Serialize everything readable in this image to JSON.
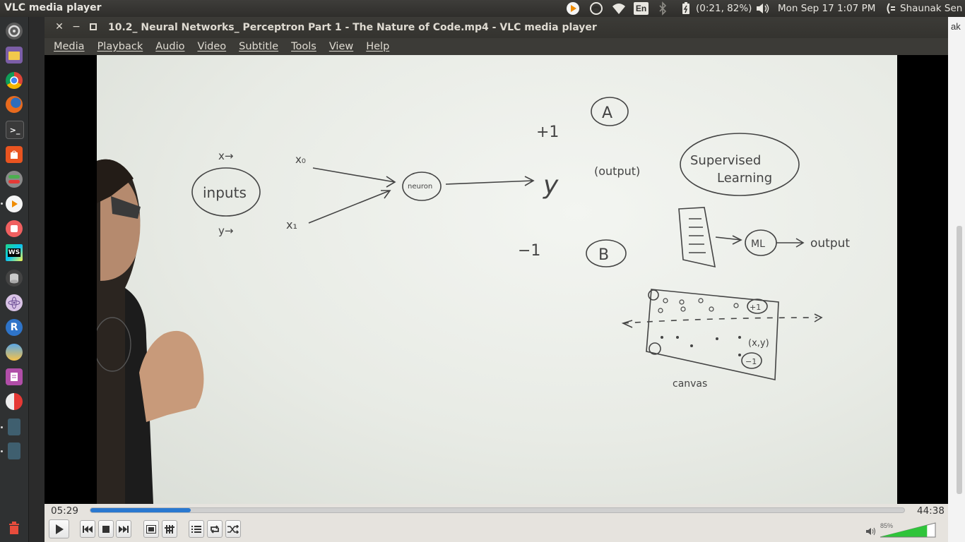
{
  "top_panel": {
    "app_title": "VLC media player",
    "battery": "(0:21, 82%)",
    "keyboard_layout": "En",
    "clock": "Mon Sep 17  1:07 PM",
    "user": "Shaunak Sen"
  },
  "launcher": {
    "items": [
      "dash-home",
      "files",
      "chrome",
      "firefox",
      "terminal",
      "software-center",
      "settings-toggle",
      "vlc",
      "app-record",
      "webstorm",
      "database",
      "atom",
      "r-studio",
      "weather",
      "document-viewer",
      "disk-usage",
      "window-a",
      "window-b"
    ],
    "trash": "trash"
  },
  "desktop_right": {
    "corner_text": "ak"
  },
  "vlc": {
    "window_title": "10.2_ Neural Networks_ Perceptron Part 1 - The Nature of Code.mp4 - VLC media player",
    "menu": [
      "Media",
      "Playback",
      "Audio",
      "Video",
      "Subtitle",
      "Tools",
      "View",
      "Help"
    ],
    "elapsed": "05:29",
    "total": "44:38",
    "progress": 0.123,
    "volume_label": "85%",
    "volume": 0.85,
    "whiteboard": {
      "inputs": "inputs",
      "x_arrow": "x→",
      "y_arrow": "y→",
      "x0": "x₀",
      "x1": "x₁",
      "neuron": "neuron",
      "y": "y",
      "plus1": "+1",
      "minus1": "−1",
      "output": "(output)",
      "A": "A",
      "B": "B",
      "supervised": "Supervised",
      "learning": "Learning",
      "ml": "ML",
      "output2": "output",
      "plus1_circle": "+1",
      "minus1_circle": "−1",
      "xy": "(x,y)",
      "canvas": "canvas"
    }
  }
}
